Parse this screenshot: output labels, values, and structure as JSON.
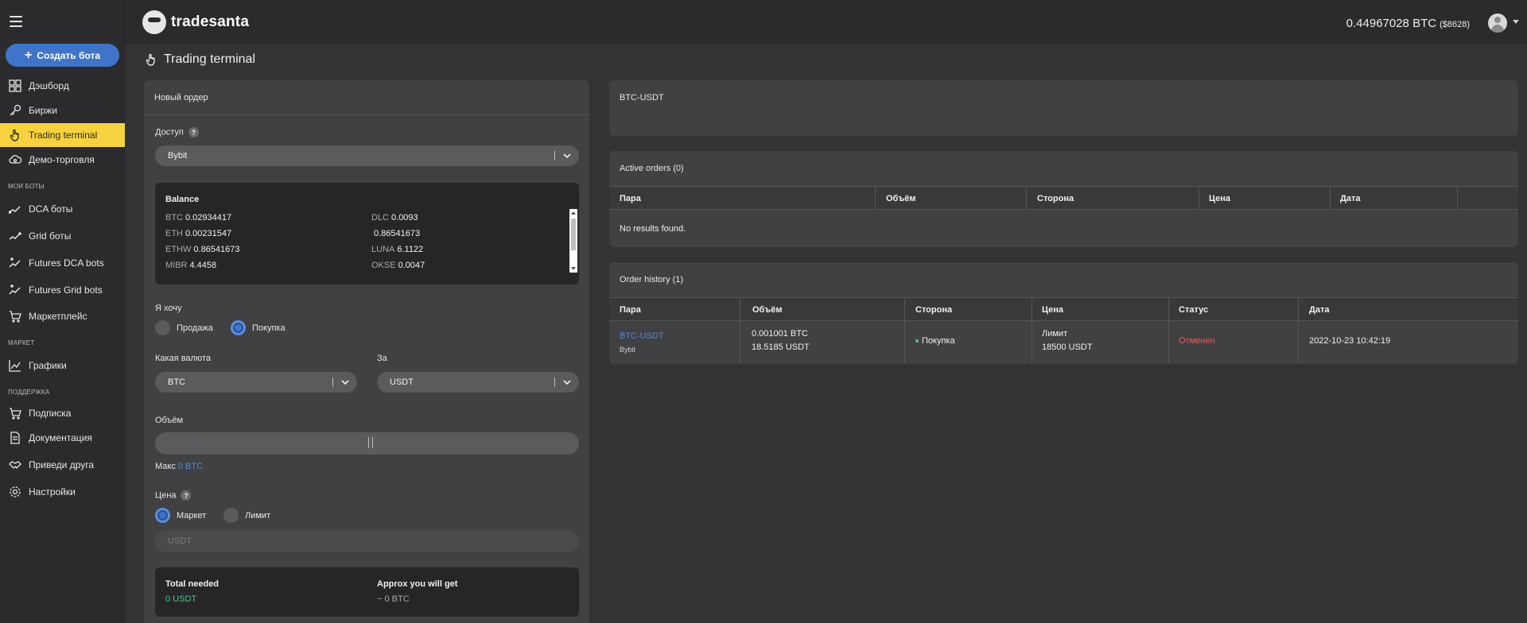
{
  "sidebar": {
    "create_button": "Создать бота",
    "items": [
      {
        "label": "Дэшборд"
      },
      {
        "label": "Биржи"
      },
      {
        "label": "Trading terminal"
      },
      {
        "label": "Демо-торговля"
      }
    ],
    "sections": {
      "my_bots": "МОИ БОТЫ",
      "market": "МАРКЕТ",
      "support": "ПОДДЕРЖКА"
    },
    "bots": [
      {
        "label": "DCA боты"
      },
      {
        "label": "Grid боты"
      },
      {
        "label": "Futures DCA bots"
      },
      {
        "label": "Futures Grid bots"
      },
      {
        "label": "Маркетплейс"
      }
    ],
    "market": [
      {
        "label": "Графики"
      }
    ],
    "support": [
      {
        "label": "Подписка"
      },
      {
        "label": "Документация"
      },
      {
        "label": "Приведи друга"
      },
      {
        "label": "Настройки"
      }
    ]
  },
  "header": {
    "logo_text": "tradesanta",
    "btc_balance": "0.44967028 BTC",
    "usd_balance": "($8628)"
  },
  "page_title": "Trading terminal",
  "order_form": {
    "title": "Новый ордер",
    "access_label": "Доступ",
    "access_value": "Bybit",
    "balance": {
      "title": "Balance",
      "left": [
        {
          "ticker": "BTC",
          "amount": "0.02934417"
        },
        {
          "ticker": "ETH",
          "amount": "0.00231547"
        },
        {
          "ticker": "ETHW",
          "amount": "0.86541673"
        },
        {
          "ticker": "MIBR",
          "amount": "4.4458"
        }
      ],
      "right": [
        {
          "ticker": "DLC",
          "amount": "0.0093"
        },
        {
          "ticker": "",
          "amount": "0.86541673"
        },
        {
          "ticker": "LUNA",
          "amount": "6.1122"
        },
        {
          "ticker": "OKSE",
          "amount": "0.0047"
        }
      ]
    },
    "want_label": "Я хочу",
    "sell_label": "Продажа",
    "buy_label": "Покупка",
    "currency_label": "Какая валюта",
    "currency_value": "BTC",
    "for_label": "За",
    "for_value": "USDT",
    "volume_label": "Объём",
    "max_label": "Макс",
    "max_value": "0 BTC",
    "price_label": "Цена",
    "market_label": "Маркет",
    "limit_label": "Лимит",
    "price_placeholder": "USDT",
    "total_needed_label": "Total needed",
    "total_needed_value": "0 USDT",
    "approx_label": "Approx you will get",
    "approx_value": "~ 0 BTC"
  },
  "pair_panel": {
    "pair": "BTC-USDT"
  },
  "active_orders": {
    "title": "Active orders (0)",
    "columns": [
      "Пара",
      "Объём",
      "Сторона",
      "Цена",
      "Дата"
    ],
    "empty": "No results found."
  },
  "order_history": {
    "title": "Order history (1)",
    "columns": [
      "Пара",
      "Объём",
      "Сторона",
      "Цена",
      "Статус",
      "Дата"
    ],
    "rows": [
      {
        "pair": "BTC-USDT",
        "exchange": "Bybit",
        "volume_btc": "0.001001 BTC",
        "volume_usdt": "18.5185 USDT",
        "side": "Покупка",
        "price_type": "Лимит",
        "price": "18500 USDT",
        "status": "Отменен",
        "date": "2022-10-23 10:42:19"
      }
    ]
  },
  "colors": {
    "accent": "#3f74c9",
    "active_nav": "#f7d240",
    "link": "#4d8ad8",
    "status_cancelled": "#e45b5b",
    "positive": "#4cc78a"
  }
}
